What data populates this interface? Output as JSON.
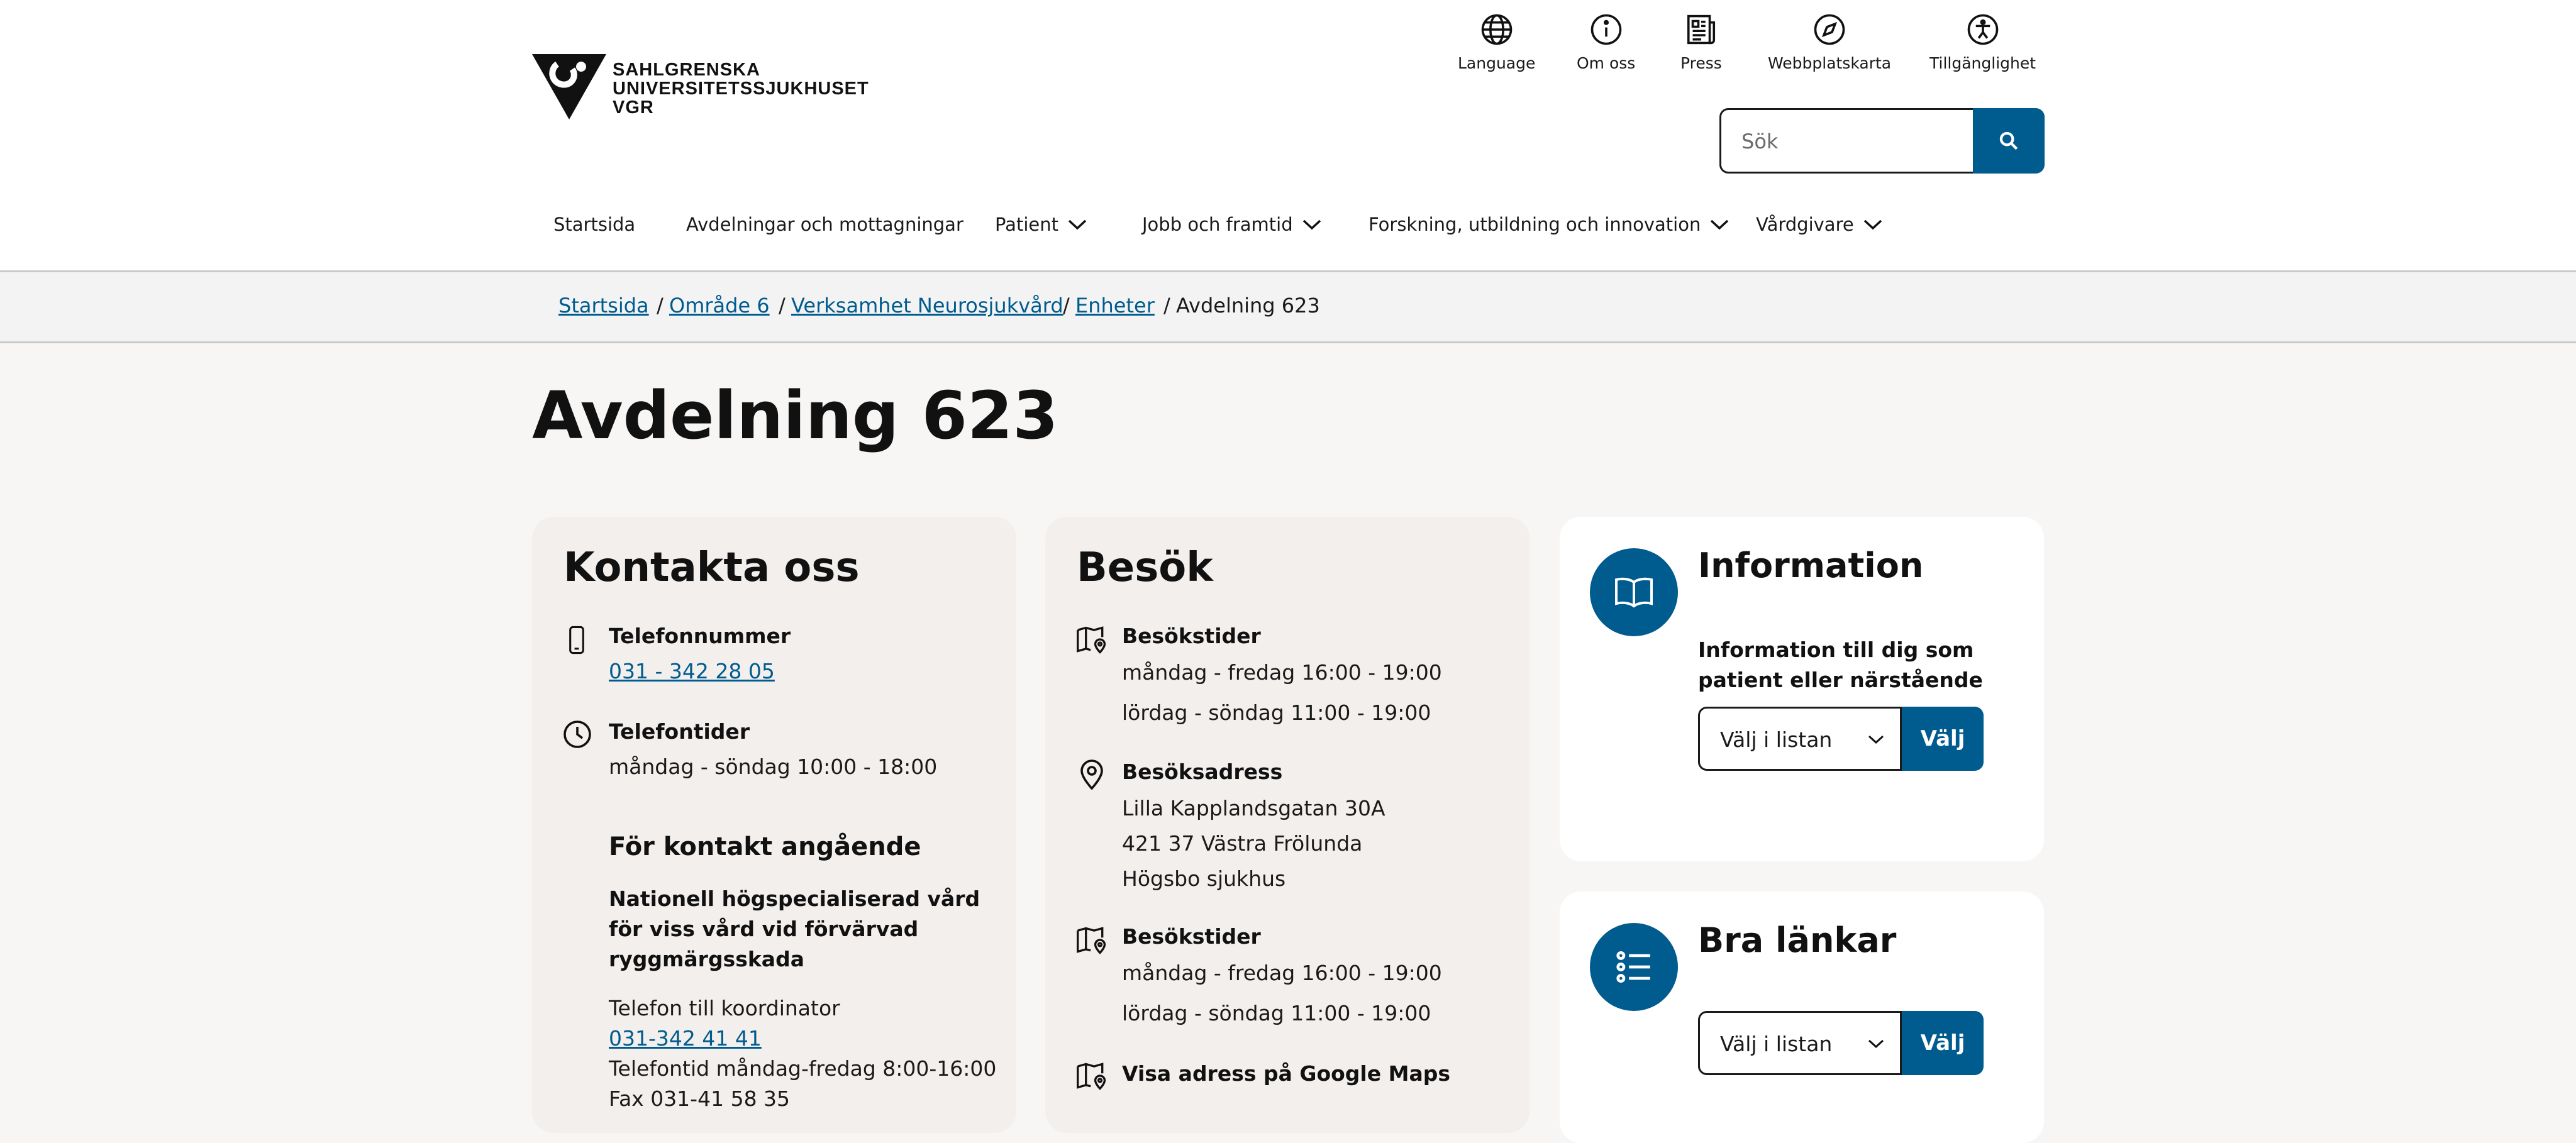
{
  "brand": {
    "line1": "SAHLGRENSKA",
    "line2": "UNIVERSITETSSJUKHUSET",
    "line3": "VGR"
  },
  "utility": {
    "language": "Language",
    "about": "Om oss",
    "press": "Press",
    "sitemap": "Webbplatskarta",
    "accessibility": "Tillgänglighet"
  },
  "search": {
    "placeholder": "Sök"
  },
  "nav": {
    "start": "Startsida",
    "departments": "Avdelningar och mottagningar",
    "patient": "Patient",
    "jobs": "Jobb och framtid",
    "research": "Forskning, utbildning och innovation",
    "caregivers": "Vårdgivare"
  },
  "breadcrumb": {
    "items": [
      "Startsida",
      "Område 6",
      "Verksamhet Neurosjukvård",
      "Enheter"
    ],
    "current": "Avdelning 623",
    "sep": "/"
  },
  "page_title": "Avdelning 623",
  "contact": {
    "title": "Kontakta oss",
    "phone_label": "Telefonnummer",
    "phone": "031 - 342 28 05",
    "hours_label": "Telefontider",
    "hours": "måndag - söndag 10:00 - 18:00",
    "about_heading": "För kontakt angående",
    "about_text": "Nationell högspecialiserad vård för viss vård vid förvärvad ryggmärgsskada",
    "coord_label": "Telefon till koordinator",
    "coord_phone": "031-342 41 41",
    "coord_hours": "Telefontid måndag-fredag 8:00-16:00",
    "fax": "Fax 031-41 58 35"
  },
  "visit": {
    "title": "Besök",
    "hours_label": "Besökstider",
    "hours_1": "måndag - fredag 16:00 - 19:00",
    "hours_2": "lördag - söndag 11:00 - 19:00",
    "address_label": "Besöksadress",
    "address_1": "Lilla Kapplandsgatan 30A",
    "address_2": "421 37 Västra Frölunda",
    "address_3": "Högsbo sjukhus",
    "hours2_label": "Besökstider",
    "hours2_1": "måndag - fredag 16:00 - 19:00",
    "hours2_2": "lördag - söndag 11:00 - 19:00",
    "maps_label": "Visa adress på Google Maps"
  },
  "information": {
    "title": "Information",
    "subtitle": "Information till dig som patient eller närstående",
    "select": "Välj i listan",
    "button": "Välj"
  },
  "links": {
    "title": "Bra länkar",
    "select": "Välj i listan",
    "button": "Välj"
  },
  "colors": {
    "accent": "#005b8e",
    "card_beige": "#f3efed",
    "page_bg": "#f7f6f5"
  }
}
